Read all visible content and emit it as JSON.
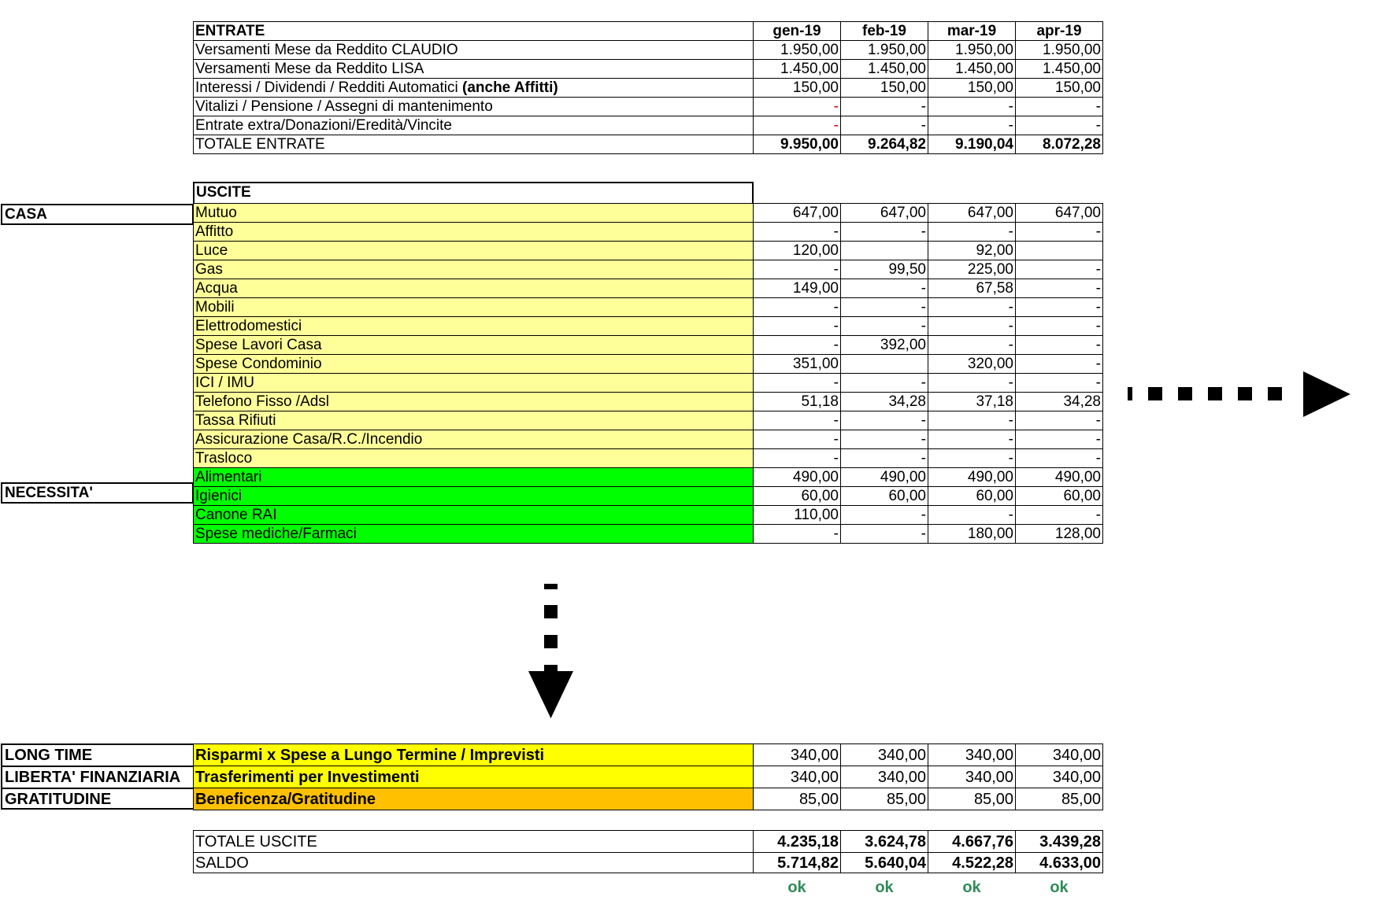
{
  "months": [
    "gen-19",
    "feb-19",
    "mar-19",
    "apr-19"
  ],
  "entrate": {
    "title": "ENTRATE",
    "rows": [
      {
        "label": "Versamenti Mese da Reddito CLAUDIO",
        "values": [
          "1.950,00",
          "1.950,00",
          "1.950,00",
          "1.950,00"
        ]
      },
      {
        "label": "Versamenti Mese da Reddito LISA",
        "values": [
          "1.450,00",
          "1.450,00",
          "1.450,00",
          "1.450,00"
        ]
      },
      {
        "label": "Interessi / Dividendi / Redditi Automatici ",
        "label_bold": "(anche Affitti)",
        "values": [
          "150,00",
          "150,00",
          "150,00",
          "150,00"
        ]
      },
      {
        "label": "Vitalizi / Pensione / Assegni di mantenimento",
        "values": [
          "-",
          "-",
          "-",
          "-"
        ]
      },
      {
        "label": "Entrate extra/Donazioni/Eredità/Vincite",
        "values": [
          "-",
          "-",
          "-",
          "-"
        ]
      }
    ],
    "total_label": "TOTALE ENTRATE",
    "totals": [
      "9.950,00",
      "9.264,82",
      "9.190,04",
      "8.072,28"
    ]
  },
  "uscite": {
    "title": "USCITE",
    "categories": {
      "casa": "CASA",
      "necessita": "NECESSITA'"
    },
    "casa_rows": [
      {
        "label": "Mutuo",
        "values": [
          "647,00",
          "647,00",
          "647,00",
          "647,00"
        ]
      },
      {
        "label": "Affitto",
        "values": [
          "-",
          "-",
          "-",
          "-"
        ]
      },
      {
        "label": "Luce",
        "values": [
          "120,00",
          "",
          "92,00",
          ""
        ]
      },
      {
        "label": "Gas",
        "values": [
          "-",
          "99,50",
          "225,00",
          "-"
        ]
      },
      {
        "label": "Acqua",
        "values": [
          "149,00",
          "-",
          "67,58",
          "-"
        ]
      },
      {
        "label": "Mobili",
        "values": [
          "-",
          "-",
          "-",
          "-"
        ]
      },
      {
        "label": "Elettrodomestici",
        "values": [
          "-",
          "-",
          "-",
          "-"
        ]
      },
      {
        "label": "Spese Lavori Casa",
        "values": [
          "-",
          "392,00",
          "-",
          "-"
        ]
      },
      {
        "label": "Spese Condominio",
        "values": [
          "351,00",
          "",
          "320,00",
          "-"
        ]
      },
      {
        "label": "ICI / IMU",
        "values": [
          "-",
          "-",
          "-",
          "-"
        ]
      },
      {
        "label": "Telefono Fisso /Adsl",
        "values": [
          "51,18",
          "34,28",
          "37,18",
          "34,28"
        ]
      },
      {
        "label": "Tassa Rifiuti",
        "values": [
          "-",
          "-",
          "-",
          "-"
        ]
      },
      {
        "label": "Assicurazione Casa/R.C./Incendio",
        "values": [
          "-",
          "-",
          "-",
          "-"
        ]
      },
      {
        "label": "Trasloco",
        "values": [
          "-",
          "-",
          "-",
          "-"
        ]
      }
    ],
    "necessita_rows": [
      {
        "label": "Alimentari",
        "values": [
          "490,00",
          "490,00",
          "490,00",
          "490,00"
        ]
      },
      {
        "label": "Igienici",
        "values": [
          "60,00",
          "60,00",
          "60,00",
          "60,00"
        ]
      },
      {
        "label": "Canone RAI",
        "values": [
          "110,00",
          "-",
          "-",
          "-"
        ]
      },
      {
        "label": "Spese mediche/Farmaci",
        "values": [
          "-",
          "-",
          "180,00",
          "128,00"
        ]
      }
    ]
  },
  "accantonamenti": [
    {
      "category": "LONG TIME",
      "label": "Risparmi x Spese a Lungo Termine / Imprevisti",
      "values": [
        "340,00",
        "340,00",
        "340,00",
        "340,00"
      ]
    },
    {
      "category": "LIBERTA' FINANZIARIA",
      "label": "Trasferimenti per Investimenti",
      "values": [
        "340,00",
        "340,00",
        "340,00",
        "340,00"
      ]
    },
    {
      "category": "GRATITUDINE",
      "label": "Beneficenza/Gratitudine",
      "values": [
        "85,00",
        "85,00",
        "85,00",
        "85,00"
      ]
    }
  ],
  "riepilogo": {
    "totale_uscite_label": "TOTALE USCITE",
    "totale_uscite": [
      "4.235,18",
      "3.624,78",
      "4.667,76",
      "3.439,28"
    ],
    "saldo_label": "SALDO",
    "saldo": [
      "5.714,82",
      "5.640,04",
      "4.522,28",
      "4.633,00"
    ],
    "status": [
      "ok",
      "ok",
      "ok",
      "ok"
    ]
  },
  "colors": {
    "casa_fill": "#ffff99",
    "necessita_fill": "#00ff00",
    "long_time_fill": "#ffff00",
    "gratitudine_fill": "#ffc000",
    "ok_text": "#2e8b57",
    "zero_dash_red": "#e00000"
  },
  "icons": [
    "arrow-right-dotted-icon",
    "arrow-down-dotted-icon"
  ]
}
